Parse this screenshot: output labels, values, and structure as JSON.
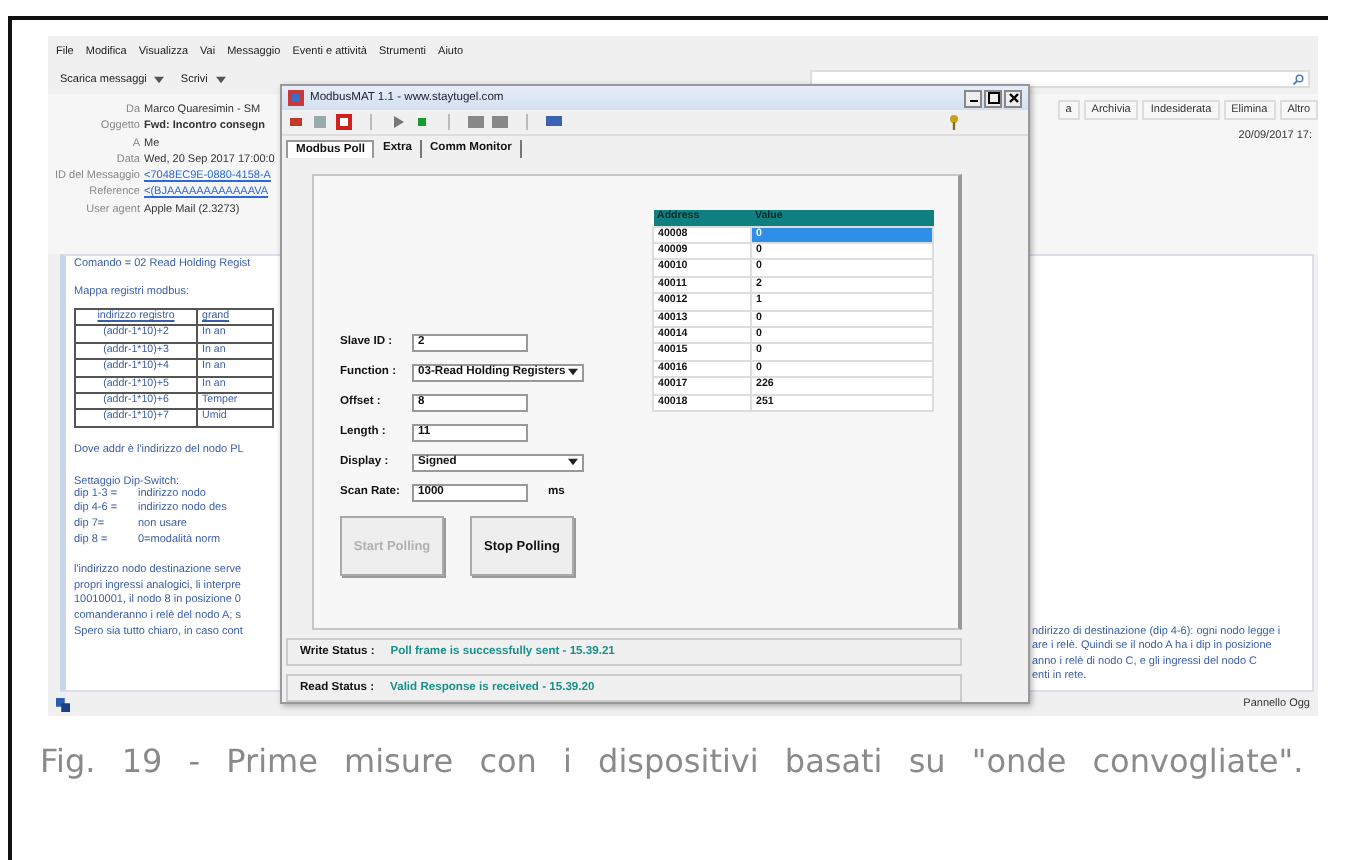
{
  "mail": {
    "menu": [
      "File",
      "Modifica",
      "Visualizza",
      "Vai",
      "Messaggio",
      "Eventi e attività",
      "Strumenti",
      "Aiuto"
    ],
    "toolbar": [
      "Scarica messaggi",
      "Scrivi"
    ],
    "actions": [
      "a",
      "Archivia",
      "Indesiderata",
      "Elimina",
      "Altro"
    ],
    "date": "20/09/2017 17:",
    "headers": [
      {
        "label": "Da",
        "value": "Marco Quaresimin - SM",
        "kind": "text"
      },
      {
        "label": "Oggetto",
        "value": "Fwd: Incontro consegn",
        "kind": "bold"
      },
      {
        "label": "A",
        "value": "Me",
        "kind": "text"
      },
      {
        "label": "Data",
        "value": "Wed, 20 Sep 2017 17:00:0",
        "kind": "text"
      },
      {
        "label": "ID del Messaggio",
        "value": "<7048EC9E-0880-4158-A",
        "kind": "link"
      },
      {
        "label": "Reference",
        "value": "<(BJAAAAAAAAAAAAVA",
        "kind": "link"
      },
      {
        "label": "User agent",
        "value": "Apple Mail (2.3273)",
        "kind": "text"
      }
    ],
    "body": {
      "intro": "Comando = 02 Read Holding Regist",
      "map_title": "Mappa registri modbus:",
      "table": {
        "columns": [
          "indirizzo registro",
          "grand"
        ],
        "rows": [
          [
            "(addr-1*10)+2",
            "In an"
          ],
          [
            "(addr-1*10)+3",
            "In an"
          ],
          [
            "(addr-1*10)+4",
            "In an"
          ],
          [
            "(addr-1*10)+5",
            "In an"
          ],
          [
            "(addr-1*10)+6",
            "Temper"
          ],
          [
            "(addr-1*10)+7",
            "Umid"
          ]
        ]
      },
      "addr_note": "Dove addr è l'indirizzo del nodo PL",
      "dip_title": "Settaggio Dip-Switch:",
      "dips": [
        [
          "dip 1-3 =",
          "indirizzo nodo"
        ],
        [
          "dip 4-6 =",
          "indirizzo nodo des"
        ],
        [
          "dip 7=",
          "non usare"
        ],
        [
          "dip 8 =",
          "0=modalità norm"
        ]
      ],
      "paragraph_left": [
        "l'indirizzo nodo destinazione serve",
        "propri ingressi analogici, li interpre",
        "10010001, il nodo 8 in posizione 0",
        "comanderanno i relè del nodo A; s",
        "Spero sia tutto chiaro, in caso cont"
      ],
      "paragraph_right": [
        "ndirizzo di destinazione (dip 4-6): ogni nodo legge i",
        "are i relè. Quindi se il nodo A ha i dip in posizione",
        "anno i relè di nodo C, e gli ingressi del nodo C",
        "enti in rete."
      ]
    },
    "status_panel": "Pannello Ogg"
  },
  "modbus": {
    "title": "ModbusMAT 1.1 - www.staytugel.com",
    "tabs": [
      {
        "label": "Modbus Poll",
        "selected": true
      },
      {
        "label": "Extra",
        "selected": false
      },
      {
        "label": "Comm Monitor",
        "selected": false
      }
    ],
    "fields": [
      {
        "label": "Slave ID :",
        "value": "2",
        "kind": "text"
      },
      {
        "label": "Function :",
        "value": "03-Read Holding Registers",
        "kind": "select"
      },
      {
        "label": "Offset :",
        "value": "8",
        "kind": "text"
      },
      {
        "label": "Length :",
        "value": "11",
        "kind": "text"
      },
      {
        "label": "Display :",
        "value": "Signed",
        "kind": "select"
      },
      {
        "label": "Scan Rate:",
        "value": "1000",
        "kind": "text",
        "unit": "ms"
      }
    ],
    "buttons": [
      {
        "label": "Start Polling",
        "disabled": true
      },
      {
        "label": "Stop Polling",
        "disabled": false
      }
    ],
    "table": {
      "columns": [
        "Address",
        "Value"
      ],
      "rows": [
        {
          "address": "40008",
          "value": "0",
          "selected": true
        },
        {
          "address": "40009",
          "value": "0",
          "selected": false
        },
        {
          "address": "40010",
          "value": "0",
          "selected": false
        },
        {
          "address": "40011",
          "value": "2",
          "selected": false
        },
        {
          "address": "40012",
          "value": "1",
          "selected": false
        },
        {
          "address": "40013",
          "value": "0",
          "selected": false
        },
        {
          "address": "40014",
          "value": "0",
          "selected": false
        },
        {
          "address": "40015",
          "value": "0",
          "selected": false
        },
        {
          "address": "40016",
          "value": "0",
          "selected": false
        },
        {
          "address": "40017",
          "value": "226",
          "selected": false
        },
        {
          "address": "40018",
          "value": "251",
          "selected": false
        }
      ]
    },
    "status": [
      {
        "label": "Write Status :",
        "value": "Poll frame is successfully sent - 15.39.21"
      },
      {
        "label": "Read Status :",
        "value": "Valid Response is received - 15.39.20"
      }
    ]
  },
  "caption": "Fig. 19 - Prime misure con i dispositivi basati su \"onde convogliate\"."
}
